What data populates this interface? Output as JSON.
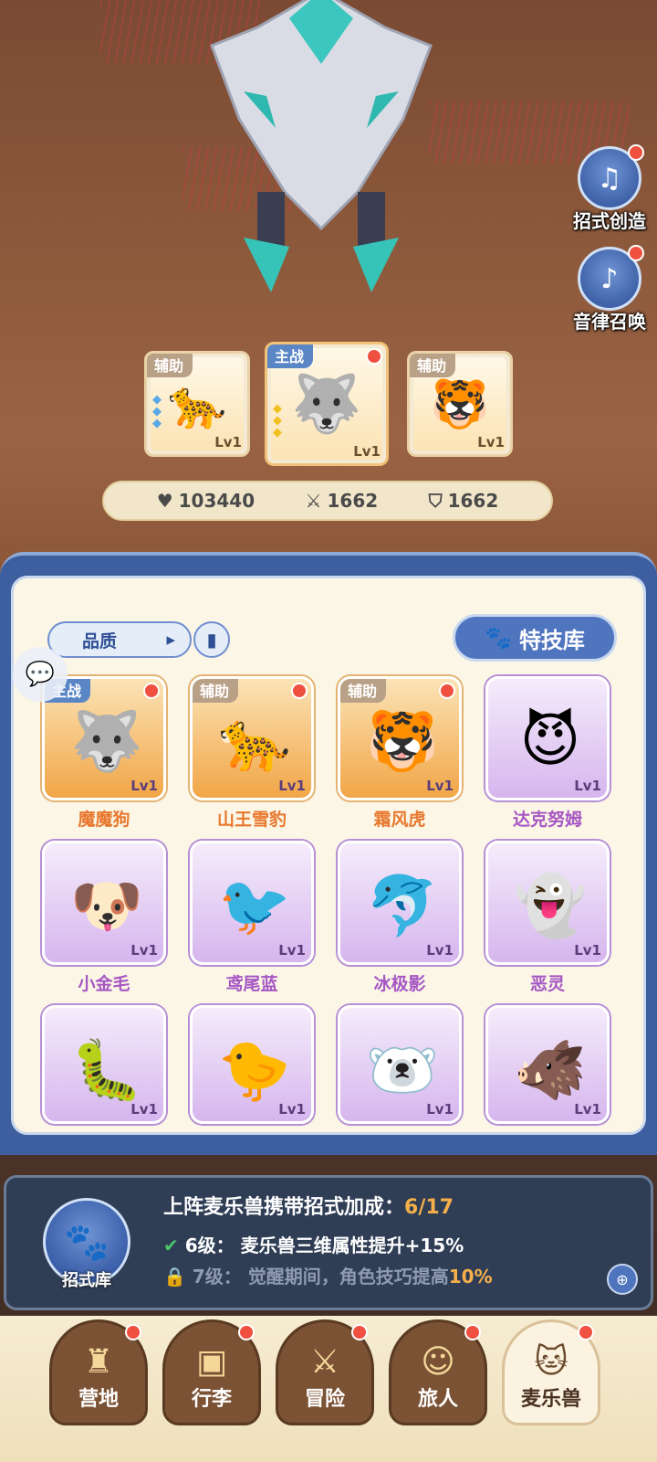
{
  "side_buttons": [
    {
      "label": "招式创造",
      "icon": "move-create-icon"
    },
    {
      "label": "音律召唤",
      "icon": "lyre-summon-icon"
    }
  ],
  "team": [
    {
      "role": "辅助",
      "level": "Lv1",
      "name": "山王雪豹"
    },
    {
      "role": "主战",
      "level": "Lv1",
      "name": "魔魔狗"
    },
    {
      "role": "辅助",
      "level": "Lv1",
      "name": "霜风虎"
    }
  ],
  "stats": {
    "hp": "103440",
    "attack": "1662",
    "defense": "1662"
  },
  "filter": {
    "label": "品质",
    "arrow": "▸"
  },
  "skill_library_btn": "特技库",
  "pets": [
    {
      "name": "魔魔狗",
      "rarity": "gold",
      "tag": "主战",
      "level": "Lv1",
      "emoji": "🐺"
    },
    {
      "name": "山王雪豹",
      "rarity": "gold",
      "tag": "辅助",
      "level": "Lv1",
      "emoji": "🐆"
    },
    {
      "name": "霜风虎",
      "rarity": "gold",
      "tag": "辅助",
      "level": "Lv1",
      "emoji": "🐯"
    },
    {
      "name": "达克努姆",
      "rarity": "purple",
      "tag": "",
      "level": "Lv1",
      "emoji": "😈"
    },
    {
      "name": "小金毛",
      "rarity": "purple",
      "tag": "",
      "level": "Lv1",
      "emoji": "🐶"
    },
    {
      "name": "鸢尾蓝",
      "rarity": "purple",
      "tag": "",
      "level": "Lv1",
      "emoji": "🐦"
    },
    {
      "name": "冰极影",
      "rarity": "purple",
      "tag": "",
      "level": "Lv1",
      "emoji": "🐬"
    },
    {
      "name": "恶灵",
      "rarity": "purple",
      "tag": "",
      "level": "Lv1",
      "emoji": "👻"
    },
    {
      "name": "",
      "rarity": "purple",
      "tag": "",
      "level": "Lv1",
      "emoji": "🐛"
    },
    {
      "name": "",
      "rarity": "purple",
      "tag": "",
      "level": "Lv1",
      "emoji": "🐤"
    },
    {
      "name": "",
      "rarity": "purple",
      "tag": "",
      "level": "Lv1",
      "emoji": "🐻‍❄️"
    },
    {
      "name": "",
      "rarity": "purple",
      "tag": "",
      "level": "Lv1",
      "emoji": "🐗"
    }
  ],
  "info": {
    "icon_label": "招式库",
    "title": "上阵麦乐兽携带招式加成：",
    "count": "6/17",
    "line1_level": "6级：",
    "line1_text": "麦乐兽三维属性提升+15%",
    "line2_level": "7级：",
    "line2_text": "觉醒期间，角色技巧提高",
    "line2_value": "10%"
  },
  "nav": [
    {
      "label": "营地",
      "icon": "castle-icon",
      "active": false
    },
    {
      "label": "行李",
      "icon": "backpack-icon",
      "active": false
    },
    {
      "label": "冒险",
      "icon": "crossed-swords-icon",
      "active": false
    },
    {
      "label": "旅人",
      "icon": "traveler-icon",
      "active": false
    },
    {
      "label": "麦乐兽",
      "icon": "pet-icon",
      "active": true
    }
  ]
}
